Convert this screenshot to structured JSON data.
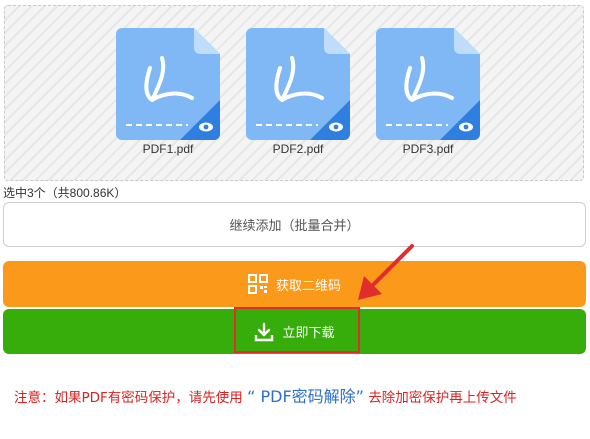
{
  "files": [
    {
      "name": "PDF1.pdf",
      "icon": "pdf-file-icon"
    },
    {
      "name": "PDF2.pdf",
      "icon": "pdf-file-icon"
    },
    {
      "name": "PDF3.pdf",
      "icon": "pdf-file-icon"
    }
  ],
  "summary": "选中3个（共800.86K）",
  "buttons": {
    "add_more": "继续添加（批量合并）",
    "qr_code": "获取二维码",
    "download": "立即下载"
  },
  "notice": {
    "prefix": "注意：如果PDF有密码保护，请先使用",
    "link": "“ PDF密码解除”",
    "suffix": "去除加密保护再上传文件"
  },
  "colors": {
    "file_icon": "#7fb8f5",
    "qr_button": "#fb9a1a",
    "download_button": "#37ad0b",
    "annotation": "#e12d2d",
    "notice_text": "#d92222",
    "link_text": "#2e6fc7"
  }
}
